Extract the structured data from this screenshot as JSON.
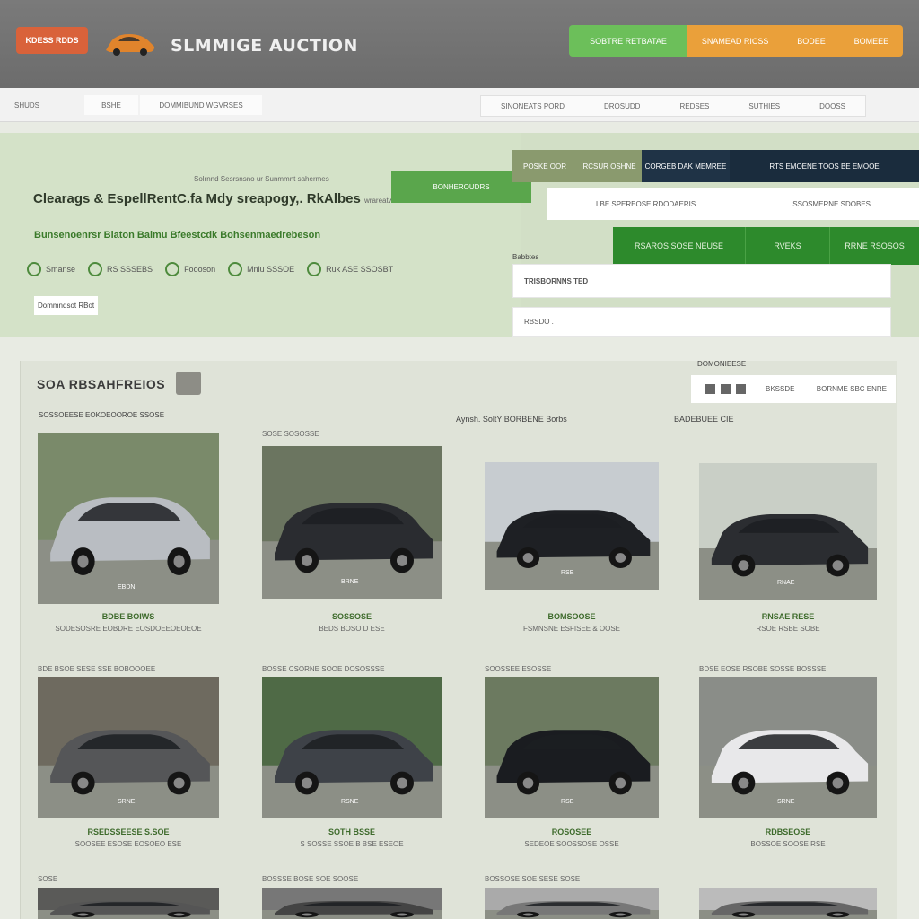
{
  "header": {
    "badge": "KDESS RDDS",
    "title": "SLMMIGE AUCTION",
    "cta_green": "SOBTRE RETBATAE",
    "cta_orange_1": "SNAMEAD RICSS",
    "cta_orange_2": "BODEE",
    "cta_orange_3": "BOMEEE"
  },
  "nav": {
    "item1": "SHUDS",
    "item2": "BSHE",
    "item3": "DOMMIBUND WGVRSES",
    "right1": "SINONEATS PORD",
    "right2": "DROSUDD",
    "right3": "REDSES",
    "right4": "SUTHIES",
    "right5": "DOOSS"
  },
  "hero": {
    "small_text": "Solrnnd Sesrsnsno ur Sunmmnt sahermes",
    "badge_line1": "BONHE",
    "badge_line2": "ROUDRS",
    "headline": "Clearags & EspellRentC.fa Mdy sreapogy,. RkAlbes",
    "headline_suffix": "wrareatwesrt",
    "sub": "Bunsenoenrsr Blaton Baimu Bfeestcdk Bohsenmaedrebeson",
    "features": [
      "Smanse",
      "RS SSSEBS",
      "Foooson",
      "Mnlu SSSOE",
      "Ruk ASE SSOSBT"
    ],
    "link": "Dommndsot RBot"
  },
  "search": {
    "tab1": "POSKE OOR",
    "tab2": "RCSUR OSHNE",
    "tab3": "CORGEB DAK MEMREE",
    "tab4": "RTS EMOENE TOOS BE EMOOE",
    "row1": "LBE SPEREOSE RDODAERIS",
    "row2": "SSOSMERNE SDOBES",
    "green1": "RSAROS SOSE NEUSE",
    "green2": "RVEKS",
    "green3": "RRNE RSOSOS",
    "label1": "Babbtes",
    "input1": "TRISBORNNS TED",
    "input2": "RBSDO ."
  },
  "listing": {
    "title": "SOA RBSAHFREIOS",
    "sort_label": "BKSSDE",
    "sort_value": "BORNME SBC ENRE",
    "sort_caption": "DOMONIEESE",
    "col_head_1": "SOSSOEESE EOKOEOOROE SSOSE",
    "col_head_2": "Aynsh. SoltY BORBENE Borbs",
    "col_head_3": "BADEBUEE CIE"
  },
  "cards": [
    {
      "head": "",
      "title": "BDBE BOIWS",
      "sub": "SODESOSRE EOBDRE EOSDOEEOEOEOE",
      "plate": "EBDN"
    },
    {
      "head": "SOSE SOSOSSE",
      "title": "SOSSOSE",
      "sub": "BEDS BOSO D ESE",
      "plate": "BRNE"
    },
    {
      "head": "",
      "title": "BOMSOOSE",
      "sub": "FSMNSNE ESFISEE & OOSE",
      "plate": "RSE"
    },
    {
      "head": "",
      "title": "RNSAE RESE",
      "sub": "RSOE RSBE SOBE",
      "plate": "RNAE"
    },
    {
      "head": "BDE BSOE SESE SSE BOBOOOEE",
      "title": "RSEDSSEESE S.SOE",
      "sub": "SOOSEE ESOSE EOSOEO ESE",
      "plate": "SRNE"
    },
    {
      "head": "BOSSE CSORNE SOOE DOSOSSSE",
      "title": "SOTH BSSE",
      "sub": "S SOSSE SSOE B BSE ESEOE",
      "plate": "RSNE"
    },
    {
      "head": "SOOSSEE ESOSSE",
      "title": "ROSOSEE",
      "sub": "SEDEOE SOOSSOSE OSSE",
      "plate": "RSE"
    },
    {
      "head": "BDSE EOSE RSOBE SOSSE BOSSSE",
      "title": "RDBSEOSE",
      "sub": "BOSSOE SOOSE RSE",
      "plate": "SRNE"
    },
    {
      "head": "SOSE",
      "title": "",
      "sub": "",
      "plate": ""
    },
    {
      "head": "BOSSSE BOSE SOE SOOSE",
      "title": "",
      "sub": "",
      "plate": ""
    },
    {
      "head": "BOSSOSE SOE SESE SOSE",
      "title": "",
      "sub": "",
      "plate": ""
    },
    {
      "head": "",
      "title": "",
      "sub": "",
      "plate": ""
    }
  ]
}
